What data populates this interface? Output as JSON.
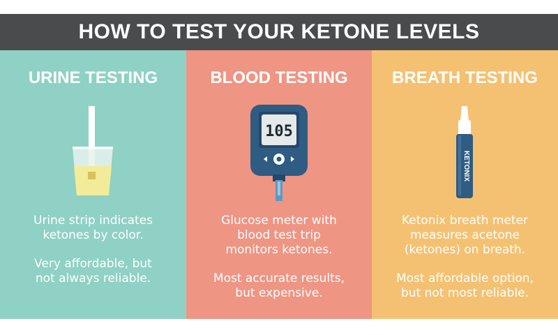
{
  "header": {
    "title": "HOW TO TEST YOUR KETONE LEVELS"
  },
  "panels": [
    {
      "title": "URINE TESTING",
      "line1": "Urine strip indicates ketones by color.",
      "line2": "Very affordable, but not always reliable.",
      "color": "#8fd1c4"
    },
    {
      "title": "BLOOD TESTING",
      "meter_reading": "105",
      "line1": "Glucose meter with blood test trip monitors ketones.",
      "line2": "Most accurate results, but expensive.",
      "color": "#ee9584"
    },
    {
      "title": "BREATH TESTING",
      "device_label": "KETONIX",
      "line1": "Ketonix breath meter measures acetone (ketones) on breath.",
      "line2": "Most affordable option, but not most reliable.",
      "color": "#f4c173"
    }
  ],
  "icons": [
    "urine-cup-icon",
    "glucose-meter-icon",
    "ketonix-breath-meter-icon"
  ]
}
